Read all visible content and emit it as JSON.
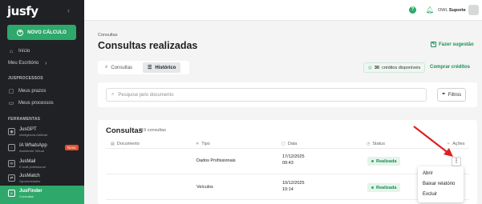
{
  "sidebar": {
    "logo": "jusfy",
    "collapse_icon": "chevron-left",
    "new_button": "NOVO CÁLCULO",
    "items": [
      {
        "label": "Início",
        "icon": "home-icon"
      },
      {
        "label": "Meu Escritório",
        "icon": "chevron-right-icon"
      }
    ],
    "sections": [
      "JUSPROCESSOS",
      "FERRAMENTAS"
    ],
    "process_items": [
      {
        "label": "Meus prazos",
        "icon": "calendar-icon"
      },
      {
        "label": "Meus processos",
        "icon": "folder-icon"
      }
    ],
    "tools": [
      {
        "title": "JusGPT",
        "subtitle": "Inteligência Artificial"
      },
      {
        "title": "IA WhatsApp",
        "subtitle": "Assistente Virtual",
        "badge": "Novo"
      },
      {
        "title": "JusMail",
        "subtitle": "E-mail profissional"
      },
      {
        "title": "JusMatch",
        "subtitle": "Oportunidades"
      },
      {
        "title": "JusFinder",
        "subtitle": "Consultas",
        "active": true
      }
    ]
  },
  "topbar": {
    "user_prefix": "OWL",
    "user_name": "Suporte",
    "help": "?"
  },
  "main": {
    "breadcrumb": "Consultas",
    "title": "Consultas realizadas",
    "suggest": "Fazer sugestão",
    "tabs": [
      {
        "label": "Consultas",
        "active": false
      },
      {
        "label": "Histórico",
        "active": true
      }
    ],
    "credits_value": "30",
    "credits_label": "créditos disponíveis",
    "buy_label": "Comprar créditos",
    "search_placeholder": "Pesquise pelo documento",
    "filter_label": "Filtros"
  },
  "table": {
    "title": "Consultas",
    "count": "319 consultas",
    "headers": [
      "Documento",
      "Tipo",
      "Data",
      "Status",
      "Ações"
    ],
    "rows": [
      {
        "documento": "",
        "tipo": "Dados Profissionais",
        "data": "17/12/2025",
        "hora": "09:43",
        "status": "Realizada"
      },
      {
        "documento": "",
        "tipo": "Veículos",
        "data": "10/12/2025",
        "hora": "10:14",
        "status": "Realizada"
      }
    ]
  },
  "context_menu": [
    "Abrir",
    "Baixar relatório",
    "Excluir"
  ],
  "colors": {
    "brand_green": "#2ea86b",
    "sidebar_bg": "#1f2124",
    "annotation_arrow": "#e02020",
    "badge_novo": "#e2502f"
  }
}
